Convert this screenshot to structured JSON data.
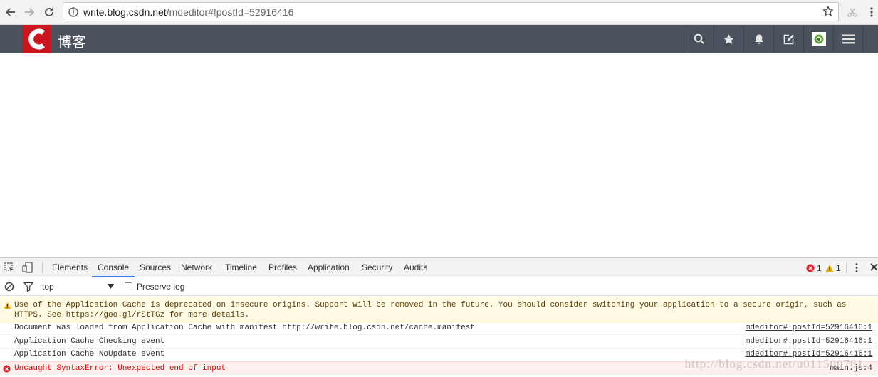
{
  "browser": {
    "url_host": "write.blog.csdn.net",
    "url_path": "/mdeditor#!postId=52916416"
  },
  "site": {
    "logo_letter": "C",
    "name": "博客"
  },
  "devtools": {
    "tabs": [
      "Elements",
      "Console",
      "Sources",
      "Network",
      "Timeline",
      "Profiles",
      "Application",
      "Security",
      "Audits"
    ],
    "active_tab": "Console",
    "error_count": "1",
    "warning_count": "1",
    "context": "top",
    "preserve_log_label": "Preserve log",
    "messages": {
      "warning": "Use of the Application Cache is deprecated on insecure origins. Support will be removed in the future. You should consider switching your application to a secure origin, such as HTTPS. See https://goo.gl/rStTGz for more details.",
      "log1": "Document was loaded from Application Cache with manifest http://write.blog.csdn.net/cache.manifest",
      "log1_src": "mdeditor#!postId=52916416:1",
      "log2": "Application Cache Checking event",
      "log2_src": "mdeditor#!postId=52916416:1",
      "log3": "Application Cache NoUpdate event",
      "log3_src": "mdeditor#!postId=52916416:1",
      "error": "Uncaught SyntaxError: Unexpected end of input",
      "error_src": "main.js:4"
    }
  },
  "watermark": "http://blog.csdn.net/u011500781",
  "colors": {
    "header_bg": "#4a525d",
    "logo_red": "#c9151e",
    "active_tab": "#3879d9",
    "error": "#e00000",
    "warning_bg": "#fffbe5"
  }
}
